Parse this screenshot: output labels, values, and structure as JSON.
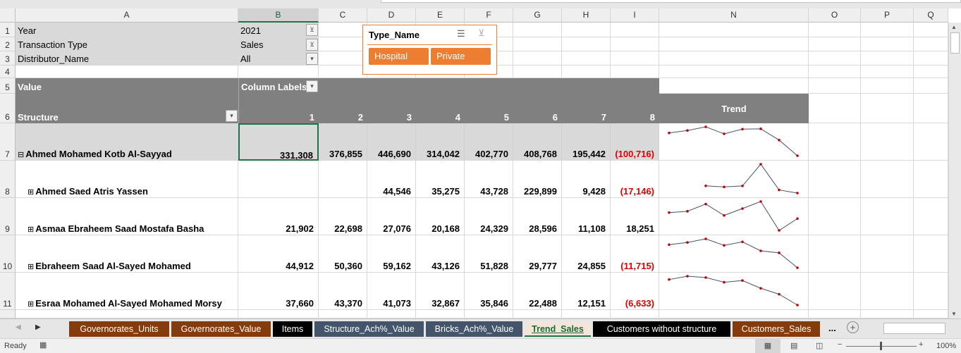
{
  "columns": [
    "A",
    "B",
    "C",
    "D",
    "E",
    "F",
    "G",
    "H",
    "I",
    "N",
    "O",
    "P",
    "Q"
  ],
  "rows": [
    "1",
    "2",
    "3",
    "4",
    "5",
    "6",
    "7",
    "8",
    "9",
    "10",
    "11"
  ],
  "filters": [
    {
      "label": "Year",
      "value": "2021"
    },
    {
      "label": "Transaction Type",
      "value": "Sales"
    },
    {
      "label": "Distributor_Name",
      "value": "All"
    }
  ],
  "pivot": {
    "value_label": "Value",
    "column_labels": "Column Labels",
    "structure_label": "Structure",
    "trend_label": "Trend",
    "col_numbers": [
      "1",
      "2",
      "3",
      "4",
      "5",
      "6",
      "7",
      "8"
    ]
  },
  "slicer": {
    "title": "Type_Name",
    "items": [
      "Hospital",
      "Private"
    ]
  },
  "data_rows": [
    {
      "name": "Ahmed Mohamed Kotb Al-Sayyad",
      "expand": "⊟",
      "values": [
        "331,308",
        "376,855",
        "446,690",
        "314,042",
        "402,770",
        "408,768",
        "195,442",
        "(100,716)"
      ],
      "nums": [
        331308,
        376855,
        446690,
        314042,
        402770,
        408768,
        195442,
        -100716
      ]
    },
    {
      "name": "Ahmed Saed Atris Yassen",
      "expand": "⊞",
      "values": [
        "",
        "",
        "44,546",
        "35,275",
        "43,728",
        "229,899",
        "9,428",
        "(17,146)"
      ],
      "nums": [
        null,
        null,
        44546,
        35275,
        43728,
        229899,
        9428,
        -17146
      ]
    },
    {
      "name": "Asmaa Ebraheem Saad Mostafa Basha",
      "expand": "⊞",
      "values": [
        "21,902",
        "22,698",
        "27,076",
        "20,168",
        "24,329",
        "28,596",
        "11,108",
        "18,251"
      ],
      "nums": [
        21902,
        22698,
        27076,
        20168,
        24329,
        28596,
        11108,
        18251
      ]
    },
    {
      "name": "Ebraheem Saad Al-Sayed Mohamed",
      "expand": "⊞",
      "values": [
        "44,912",
        "50,360",
        "59,162",
        "43,126",
        "51,828",
        "29,777",
        "24,855",
        "(11,715)"
      ],
      "nums": [
        44912,
        50360,
        59162,
        43126,
        51828,
        29777,
        24855,
        -11715
      ]
    },
    {
      "name": "Esraa Mohamed Al-Sayed Mohamed Morsy",
      "expand": "⊞",
      "values": [
        "37,660",
        "43,370",
        "41,073",
        "32,867",
        "35,846",
        "22,488",
        "12,151",
        "(6,633)"
      ],
      "nums": [
        37660,
        43370,
        41073,
        32867,
        35846,
        22488,
        12151,
        -6633
      ]
    }
  ],
  "sheet_tabs": [
    {
      "label": "Governorates_Units",
      "bg": "#843c0c"
    },
    {
      "label": "Governorates_Value",
      "bg": "#843c0c"
    },
    {
      "label": "Items",
      "bg": "#000000"
    },
    {
      "label": "Structure_Ach%_Value",
      "bg": "#44546a"
    },
    {
      "label": "Bricks_Ach%_Value",
      "bg": "#44546a"
    },
    {
      "label": "Trend_Sales",
      "bg": "#f2e5d9",
      "active": true
    },
    {
      "label": "Customers without structure",
      "bg": "#000000"
    },
    {
      "label": "Customers_Sales",
      "bg": "#843c0c"
    }
  ],
  "tabs_more": "...",
  "status": {
    "ready": "Ready",
    "zoom": "100%"
  },
  "colors": {
    "accent": "#ed7d31",
    "negative": "#e00000",
    "spark_line": "#44546a",
    "spark_marker": "#c00000"
  }
}
